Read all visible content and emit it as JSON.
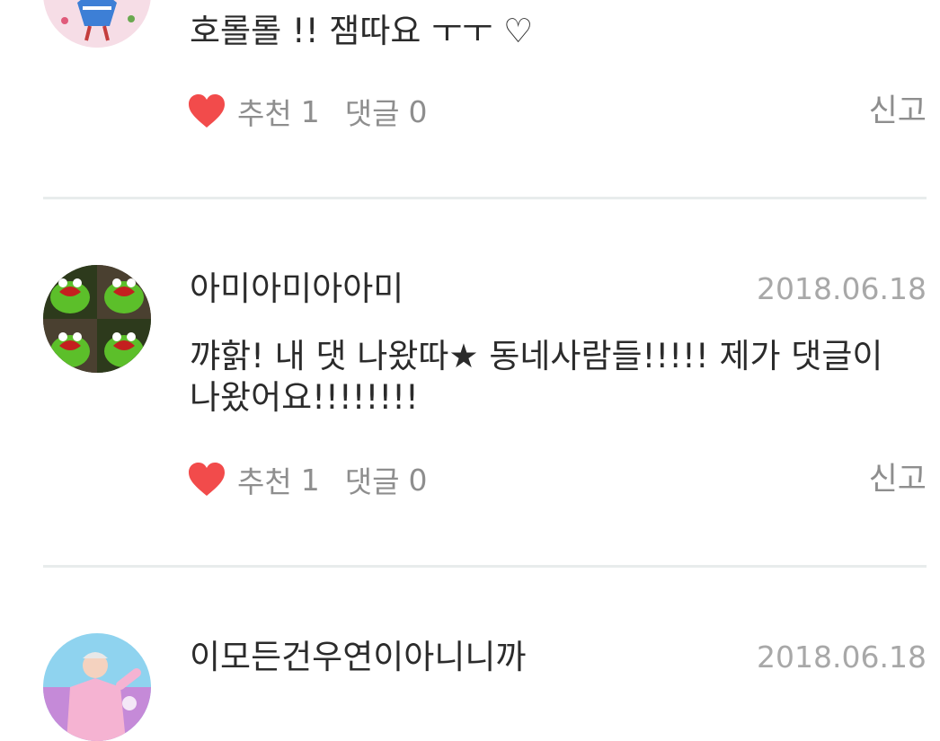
{
  "comments": [
    {
      "username": "",
      "date": "",
      "text": "호롤롤 !! 잼따요 ㅜㅜ ♡",
      "like_label": "추천",
      "like_count": "1",
      "reply_label": "댓글",
      "reply_count": "0",
      "report_label": "신고",
      "avatar_icon": "avatar-girl-blue-dress"
    },
    {
      "username": "아미아미아아미",
      "date": "2018.06.18",
      "text": "꺄핡! 내 댓 나왔따★ 동네사람들!!!!! 제가 댓글이 나왔어요!!!!!!!!",
      "like_label": "추천",
      "like_count": "1",
      "reply_label": "댓글",
      "reply_count": "0",
      "report_label": "신고",
      "avatar_icon": "avatar-green-frog-grid"
    },
    {
      "username": "이모든건우연이아니니까",
      "date": "2018.06.18",
      "text": "",
      "avatar_icon": "avatar-pink-outfit-person"
    }
  ],
  "colors": {
    "heart": "#f24b4b",
    "text": "#2b2b2b",
    "muted": "#8e8e8e",
    "date": "#a8a8a8",
    "divider": "#e8ecec"
  }
}
